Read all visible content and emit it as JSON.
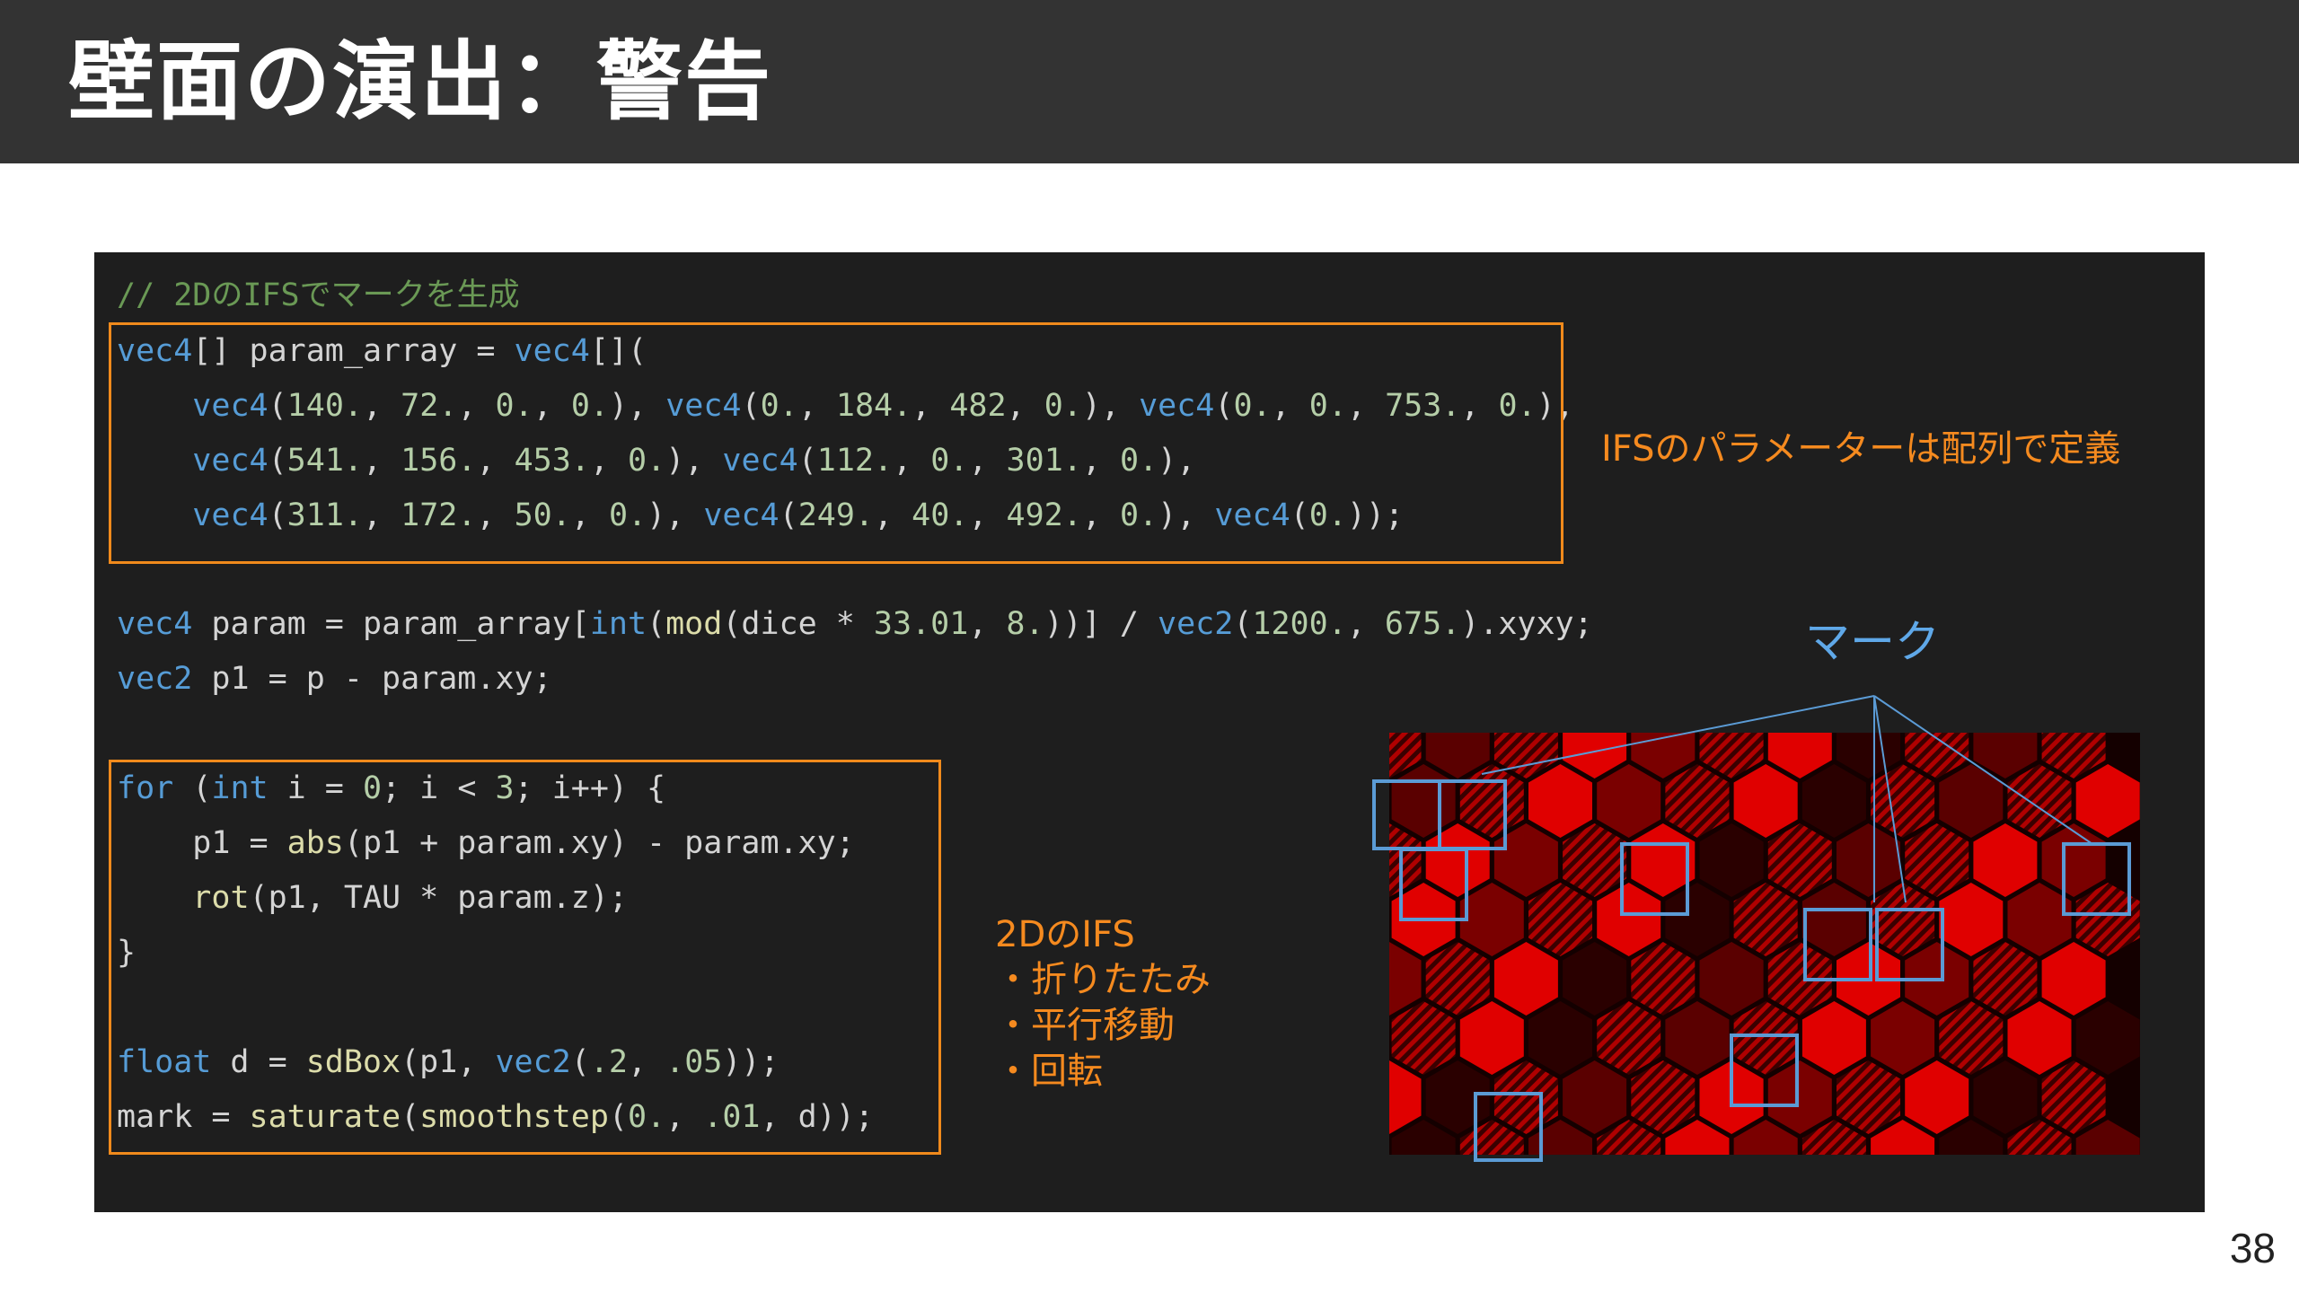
{
  "slide": {
    "title": "壁面の演出：警告",
    "page_number": "38"
  },
  "colors": {
    "title_bar": "#333333",
    "code_background": "#1e1e1e",
    "highlight_box": "#f08a1c",
    "annotation": "#f58a1f",
    "mark_box": "#5b9bd5",
    "keyword": "#569cd6",
    "function": "#dcdcaa",
    "number": "#b5cea8",
    "comment": "#6a9955",
    "hex_red": "#e60000"
  },
  "code": {
    "comment": "// 2DのIFSでマークを生成",
    "lines": [
      "vec4[] param_array = vec4[](",
      "    vec4(140., 72., 0., 0.), vec4(0., 184., 482, 0.), vec4(0., 0., 753., 0.),",
      "    vec4(541., 156., 453., 0.), vec4(112., 0., 301., 0.),",
      "    vec4(311., 172., 50., 0.), vec4(249., 40., 492., 0.), vec4(0.));",
      "vec4 param = param_array[int(mod(dice * 33.01, 8.))] / vec2(1200., 675.).xyxy;",
      "vec2 p1 = p - param.xy;",
      "for (int i = 0; i < 3; i++) {",
      "    p1 = abs(p1 + param.xy) - param.xy;",
      "    rot(p1, TAU * param.z);",
      "}",
      "float d = sdBox(p1, vec2(.2, .05));",
      "mark = saturate(smoothstep(0., .01, d));"
    ]
  },
  "annotations": {
    "param_note": "IFSのパラメーターは配列で定義",
    "ifs_title": "2DのIFS",
    "ifs_items": [
      "・折りたたみ",
      "・平行移動",
      "・回転"
    ],
    "mark_label": "マーク"
  },
  "hex_image": {
    "description_icon": "hexagon-warning-pattern"
  }
}
